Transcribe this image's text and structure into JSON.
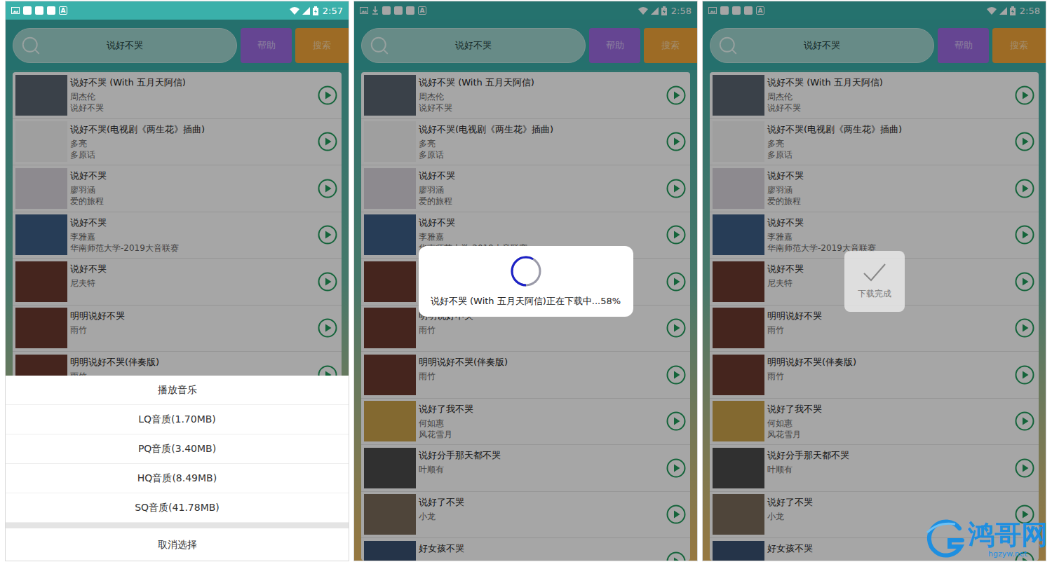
{
  "songs": [
    {
      "title": "说好不哭 (With 五月天阿信)",
      "artist": "周杰伦",
      "album": "说好不哭"
    },
    {
      "title": "说好不哭(电视剧《两生花》插曲)",
      "artist": "多亮",
      "album": "多原话"
    },
    {
      "title": "说好不哭",
      "artist": "廖羽涵",
      "album": "爱的旅程"
    },
    {
      "title": "说好不哭",
      "artist": "李雅嘉",
      "album": "华南师范大学-2019大音联赛"
    },
    {
      "title": "说好不哭",
      "artist": "尼夫特",
      "album": ""
    },
    {
      "title": "明明说好不哭",
      "artist": "雨竹",
      "album": ""
    },
    {
      "title": "明明说好不哭(伴奏版)",
      "artist": "雨竹",
      "album": ""
    },
    {
      "title": "说好了我不哭",
      "artist": "何如惠",
      "album": "风花雪月"
    },
    {
      "title": "说好分手那天都不哭",
      "artist": "叶顺有",
      "album": ""
    },
    {
      "title": "说好了不哭",
      "artist": "小龙",
      "album": ""
    },
    {
      "title": "好女孩不哭",
      "artist": "",
      "album": ""
    }
  ],
  "panels": [
    {
      "status_bar": {
        "time": "2:57",
        "downloading": false,
        "glyph": "A"
      },
      "search": {
        "value": "说好不哭"
      },
      "buttons": [
        "帮助",
        "搜索"
      ],
      "overlay": {
        "kind": "sheet",
        "items": [
          "播放音乐",
          "LQ音质(1.70MB)",
          "PQ音质(3.40MB)",
          "HQ音质(8.49MB)",
          "SQ音质(41.78MB)"
        ],
        "cancel": "取消选择"
      }
    },
    {
      "status_bar": {
        "time": "2:58",
        "downloading": true,
        "glyph": "A"
      },
      "search": {
        "value": "说好不哭"
      },
      "buttons": [
        "帮助",
        "搜索"
      ],
      "overlay": {
        "kind": "progress",
        "text": "说好不哭 (With 五月天阿信)正在下载中...58%",
        "level": 0.58
      }
    },
    {
      "status_bar": {
        "time": "2:58",
        "downloading": false,
        "glyph": "A"
      },
      "search": {
        "value": "说好不哭"
      },
      "buttons": [
        "帮助",
        "搜索"
      ],
      "overlay": {
        "kind": "toast",
        "text": "下载完成"
      }
    }
  ],
  "watermark": {
    "name": "鸿哥网",
    "url": "hgzyw.net"
  }
}
